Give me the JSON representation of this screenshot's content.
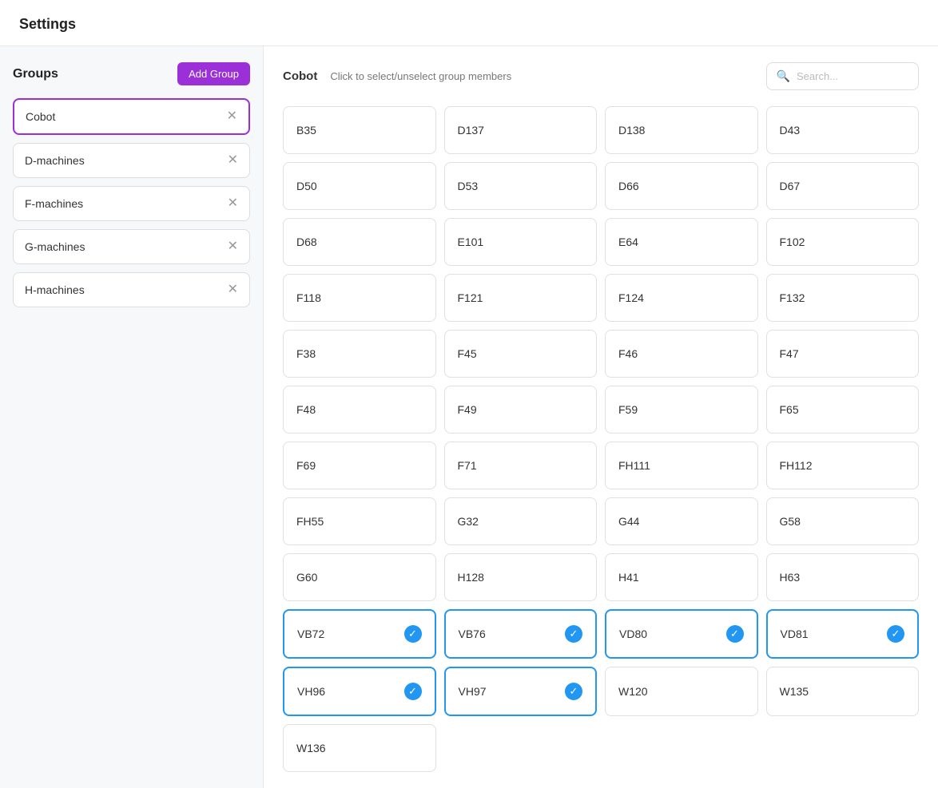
{
  "page": {
    "title": "Settings"
  },
  "sidebar": {
    "title": "Groups",
    "add_button_label": "Add Group",
    "groups": [
      {
        "id": "cobot",
        "label": "Cobot",
        "active": true
      },
      {
        "id": "d-machines",
        "label": "D-machines",
        "active": false
      },
      {
        "id": "f-machines",
        "label": "F-machines",
        "active": false
      },
      {
        "id": "g-machines",
        "label": "G-machines",
        "active": false
      },
      {
        "id": "h-machines",
        "label": "H-machines",
        "active": false
      }
    ]
  },
  "content": {
    "group_name": "Cobot",
    "instruction": "Click to select/unselect group members",
    "search_placeholder": "Search...",
    "machines": [
      {
        "id": "B35",
        "label": "B35",
        "selected": false
      },
      {
        "id": "D137",
        "label": "D137",
        "selected": false
      },
      {
        "id": "D138",
        "label": "D138",
        "selected": false
      },
      {
        "id": "D43",
        "label": "D43",
        "selected": false
      },
      {
        "id": "D50",
        "label": "D50",
        "selected": false
      },
      {
        "id": "D53",
        "label": "D53",
        "selected": false
      },
      {
        "id": "D66",
        "label": "D66",
        "selected": false
      },
      {
        "id": "D67",
        "label": "D67",
        "selected": false
      },
      {
        "id": "D68",
        "label": "D68",
        "selected": false
      },
      {
        "id": "E101",
        "label": "E101",
        "selected": false
      },
      {
        "id": "E64",
        "label": "E64",
        "selected": false
      },
      {
        "id": "F102",
        "label": "F102",
        "selected": false
      },
      {
        "id": "F118",
        "label": "F118",
        "selected": false
      },
      {
        "id": "F121",
        "label": "F121",
        "selected": false
      },
      {
        "id": "F124",
        "label": "F124",
        "selected": false
      },
      {
        "id": "F132",
        "label": "F132",
        "selected": false
      },
      {
        "id": "F38",
        "label": "F38",
        "selected": false
      },
      {
        "id": "F45",
        "label": "F45",
        "selected": false
      },
      {
        "id": "F46",
        "label": "F46",
        "selected": false
      },
      {
        "id": "F47",
        "label": "F47",
        "selected": false
      },
      {
        "id": "F48",
        "label": "F48",
        "selected": false
      },
      {
        "id": "F49",
        "label": "F49",
        "selected": false
      },
      {
        "id": "F59",
        "label": "F59",
        "selected": false
      },
      {
        "id": "F65",
        "label": "F65",
        "selected": false
      },
      {
        "id": "F69",
        "label": "F69",
        "selected": false
      },
      {
        "id": "F71",
        "label": "F71",
        "selected": false
      },
      {
        "id": "FH111",
        "label": "FH111",
        "selected": false
      },
      {
        "id": "FH112",
        "label": "FH112",
        "selected": false
      },
      {
        "id": "FH55",
        "label": "FH55",
        "selected": false
      },
      {
        "id": "G32",
        "label": "G32",
        "selected": false
      },
      {
        "id": "G44",
        "label": "G44",
        "selected": false
      },
      {
        "id": "G58",
        "label": "G58",
        "selected": false
      },
      {
        "id": "G60",
        "label": "G60",
        "selected": false
      },
      {
        "id": "H128",
        "label": "H128",
        "selected": false
      },
      {
        "id": "H41",
        "label": "H41",
        "selected": false
      },
      {
        "id": "H63",
        "label": "H63",
        "selected": false
      },
      {
        "id": "VB72",
        "label": "VB72",
        "selected": true
      },
      {
        "id": "VB76",
        "label": "VB76",
        "selected": true
      },
      {
        "id": "VD80",
        "label": "VD80",
        "selected": true
      },
      {
        "id": "VD81",
        "label": "VD81",
        "selected": true
      },
      {
        "id": "VH96",
        "label": "VH96",
        "selected": true
      },
      {
        "id": "VH97",
        "label": "VH97",
        "selected": true
      },
      {
        "id": "W120",
        "label": "W120",
        "selected": false
      },
      {
        "id": "W135",
        "label": "W135",
        "selected": false
      },
      {
        "id": "W136",
        "label": "W136",
        "selected": false
      }
    ]
  }
}
